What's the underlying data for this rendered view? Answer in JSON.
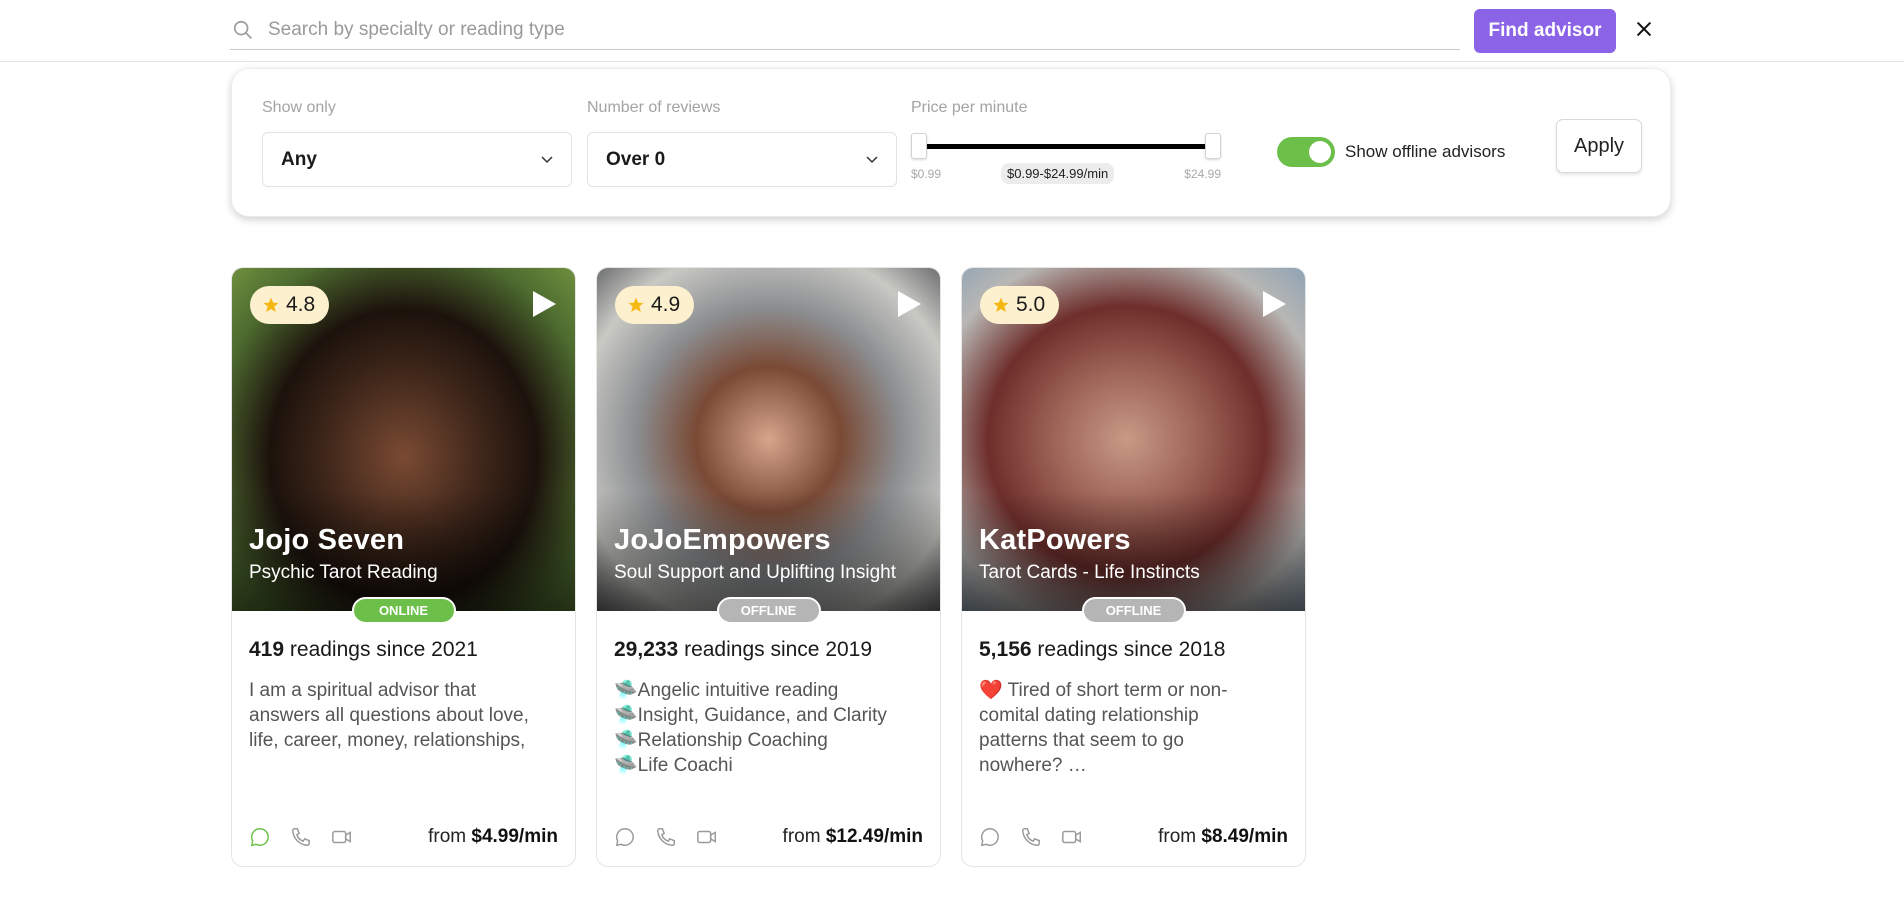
{
  "search": {
    "placeholder": "Search by specialty or reading type",
    "value": "",
    "find_label": "Find advisor"
  },
  "filters": {
    "show_only": {
      "label": "Show only",
      "value": "Any"
    },
    "reviews": {
      "label": "Number of reviews",
      "value": "Over 0"
    },
    "price": {
      "label": "Price per minute",
      "min_label": "$0.99",
      "max_label": "$24.99",
      "selected_label": "$0.99-$24.99/min",
      "selected_min": 0.99,
      "selected_max": 24.99
    },
    "offline": {
      "label": "Show offline advisors",
      "enabled": true
    },
    "apply_label": "Apply"
  },
  "colors": {
    "accent": "#8b63e6",
    "online": "#6cc04a",
    "offline": "#b5b5b5",
    "rating_bg": "#fdf0cf",
    "star": "#f6b913"
  },
  "advisors": [
    {
      "name": "Jojo Seven",
      "specialty": "Psychic Tarot Reading",
      "rating": "4.8",
      "status": "ONLINE",
      "readings_count": "419",
      "readings_text": "readings since 2021",
      "description": [
        "I am a spiritual advisor that",
        "answers all questions about love,",
        "life, career, money, relationships,"
      ],
      "price_prefix": "from",
      "price": "$4.99/min",
      "chat_active": true
    },
    {
      "name": "JoJoEmpowers",
      "specialty": "Soul Support and Uplifting Insight",
      "rating": "4.9",
      "status": "OFFLINE",
      "readings_count": "29,233",
      "readings_text": "readings since 2019",
      "description": [
        "🛸Angelic intuitive reading",
        "🛸Insight,  Guidance, and Clarity",
        "🛸Relationship Coaching",
        "🛸Life Coachi"
      ],
      "price_prefix": "from",
      "price": "$12.49/min",
      "chat_active": false
    },
    {
      "name": "KatPowers",
      "specialty": "Tarot Cards - Life Instincts",
      "rating": "5.0",
      "status": "OFFLINE",
      "readings_count": "5,156",
      "readings_text": "readings since 2018",
      "description": [
        "❤️ Tired of short term or non-",
        "comital dating relationship",
        "patterns that seem to go",
        "nowhere? …"
      ],
      "price_prefix": "from",
      "price": "$8.49/min",
      "chat_active": false
    }
  ]
}
